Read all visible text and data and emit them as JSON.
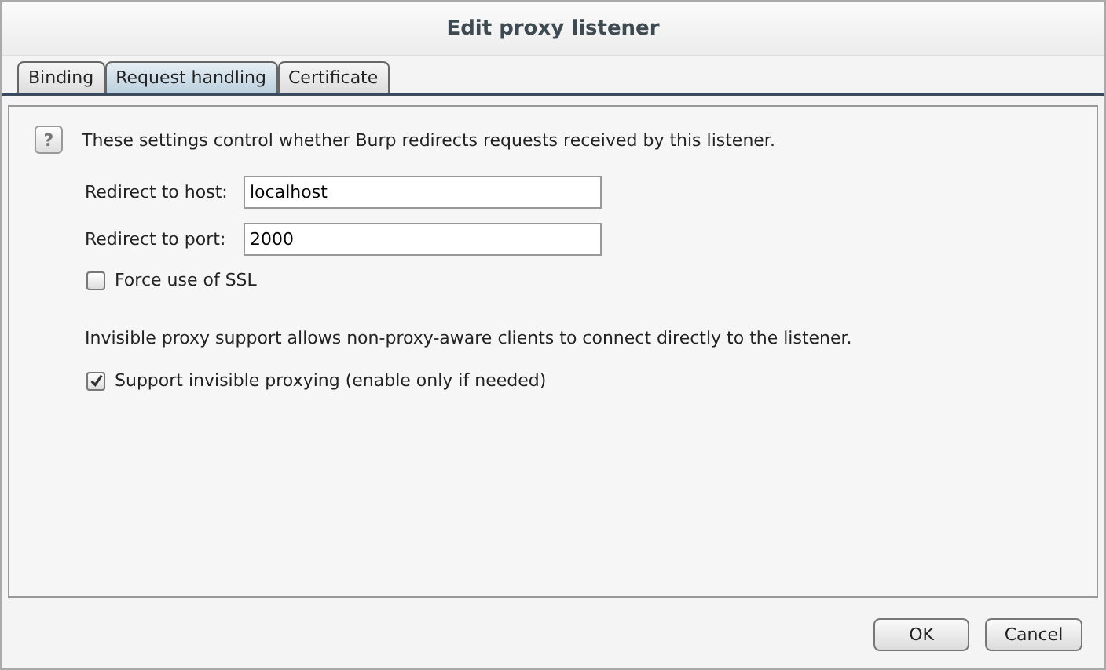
{
  "window": {
    "title": "Edit proxy listener"
  },
  "tabs": [
    {
      "label": "Binding",
      "selected": false
    },
    {
      "label": "Request handling",
      "selected": true
    },
    {
      "label": "Certificate",
      "selected": false
    }
  ],
  "help": {
    "icon_text": "?",
    "text": "These settings control whether Burp redirects requests received by this listener."
  },
  "fields": [
    {
      "label": "Redirect to host:",
      "value": "localhost"
    },
    {
      "label": "Redirect to port:",
      "value": "2000"
    }
  ],
  "force_ssl": {
    "label": "Force use of SSL",
    "checked": false
  },
  "invisible_note": "Invisible proxy support allows non-proxy-aware clients to connect directly to the listener.",
  "invisible": {
    "label": "Support invisible proxying (enable only if needed)",
    "checked": true
  },
  "buttons": [
    "OK",
    "Cancel"
  ]
}
